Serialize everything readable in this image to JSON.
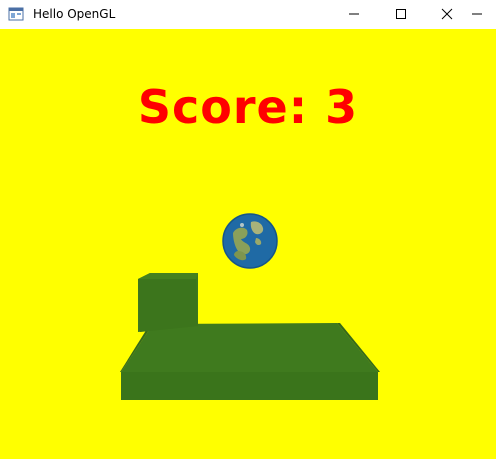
{
  "window": {
    "title": "Hello OpenGL",
    "controls": {
      "minimize_icon": "minimize-icon",
      "maximize_icon": "maximize-icon",
      "close_icon": "close-icon",
      "extra_icon": "minimize-icon"
    }
  },
  "game": {
    "score_text": "Score: 3",
    "background_color": "#ffff00",
    "score_color": "#ff0000",
    "platform_color": "#3f7a1e",
    "ball_icon": "earth-globe"
  }
}
